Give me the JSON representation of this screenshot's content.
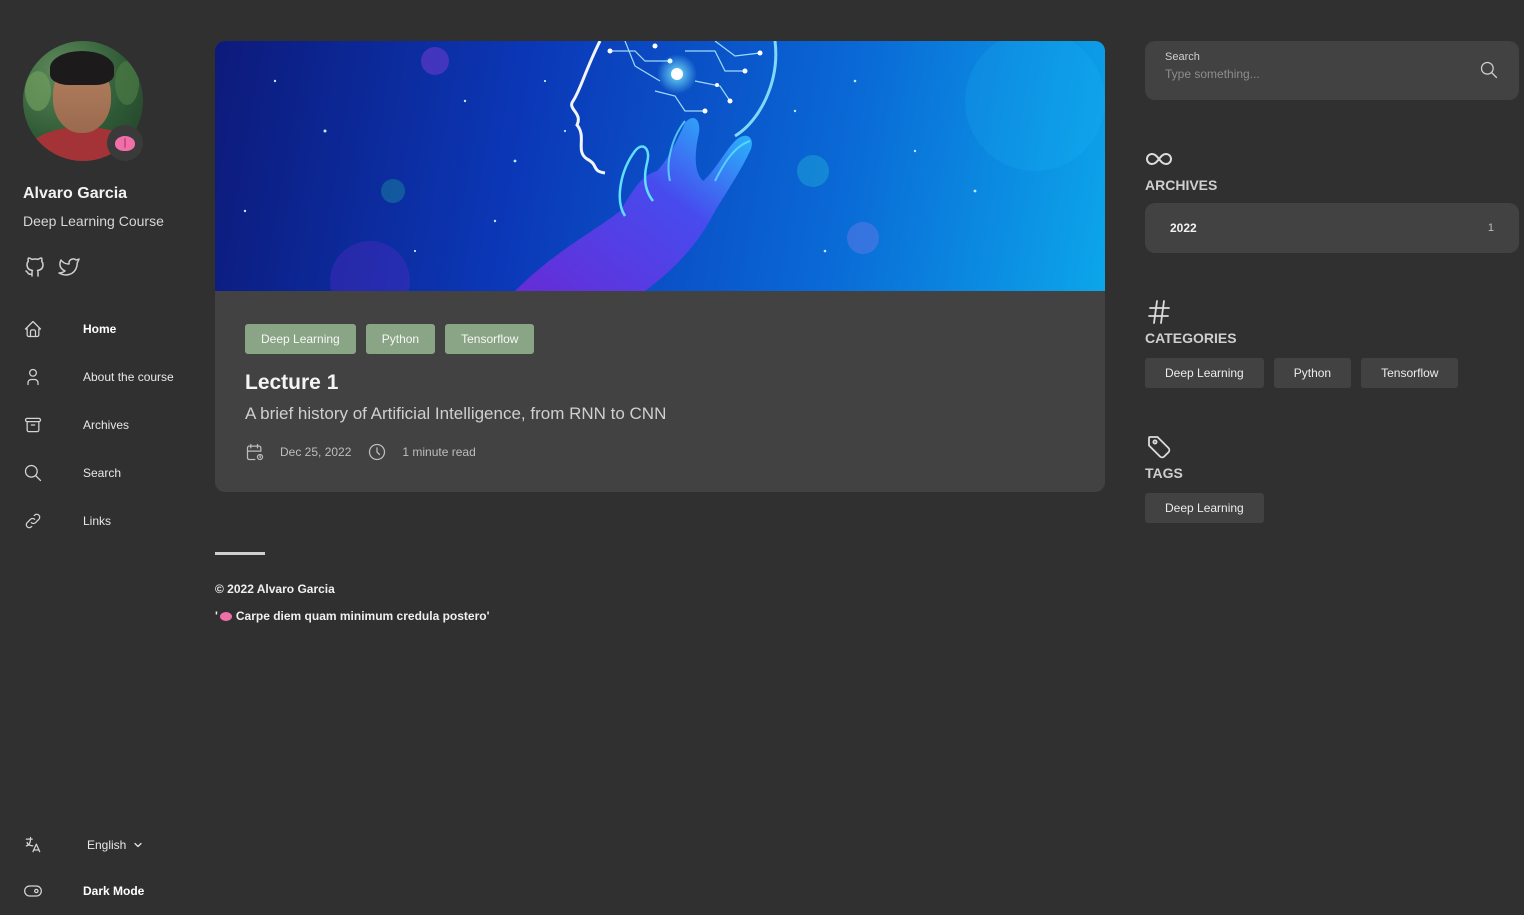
{
  "author": {
    "name": "Alvaro Garcia",
    "subtitle": "Deep Learning Course",
    "emoji_icon": "brain-emoji",
    "social": [
      {
        "icon": "github-icon"
      },
      {
        "icon": "twitter-icon"
      }
    ]
  },
  "menu": [
    {
      "label": "Home",
      "icon": "home-icon",
      "active": true
    },
    {
      "label": "About the course",
      "icon": "user-icon",
      "active": false
    },
    {
      "label": "Archives",
      "icon": "archive-icon",
      "active": false
    },
    {
      "label": "Search",
      "icon": "search-icon",
      "active": false
    },
    {
      "label": "Links",
      "icon": "link-icon",
      "active": false
    }
  ],
  "language": {
    "label": "English",
    "icon": "language-icon"
  },
  "dark_mode": {
    "label": "Dark Mode",
    "icon": "toggle-icon"
  },
  "post": {
    "categories": [
      "Deep Learning",
      "Python",
      "Tensorflow"
    ],
    "title": "Lecture 1",
    "subtitle": "A brief history of Artificial Intelligence, from RNN to CNN",
    "date": "Dec 25, 2022",
    "read_time": "1 minute read"
  },
  "footer": {
    "copyright": "© 2022 Alvaro Garcia",
    "quote_prefix": "'",
    "quote": "Carpe diem quam minimum credula postero'"
  },
  "search": {
    "label": "Search",
    "placeholder": "Type something..."
  },
  "archives": {
    "title": "ARCHIVES",
    "items": [
      {
        "year": "2022",
        "count": "1"
      }
    ]
  },
  "categories": {
    "title": "CATEGORIES",
    "items": [
      "Deep Learning",
      "Python",
      "Tensorflow"
    ]
  },
  "tags": {
    "title": "TAGS",
    "items": [
      "Deep Learning"
    ]
  },
  "colors": {
    "background": "#303030",
    "card": "#424242",
    "category_badge": "#8aa585",
    "emoji_pink": "#f06fa8"
  }
}
